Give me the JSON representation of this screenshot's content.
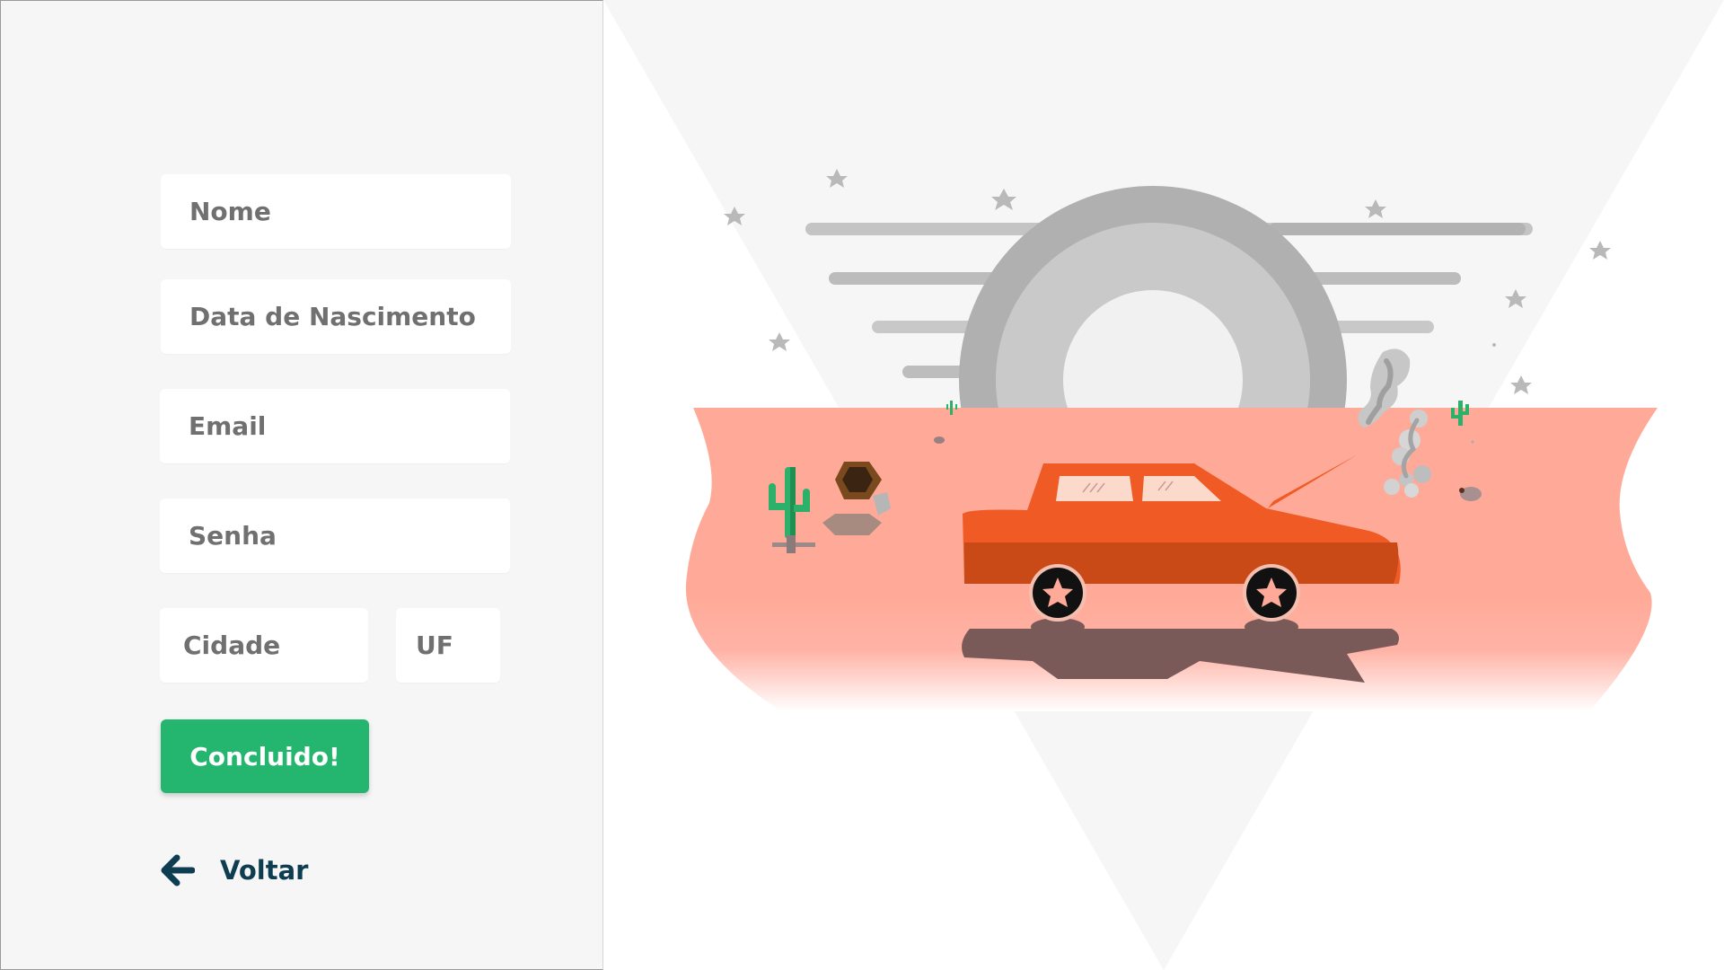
{
  "form": {
    "name_placeholder": "Nome",
    "birthdate_placeholder": "Data de Nascimento",
    "email_placeholder": "Email",
    "password_placeholder": "Senha",
    "city_placeholder": "Cidade",
    "state_placeholder": "UF",
    "submit_label": "Concluido!",
    "back_label": "Voltar"
  },
  "icons": {
    "back": "arrow-left-icon"
  },
  "colors": {
    "panel_background": "#f6f6f6",
    "submit_button": "#24b56f",
    "back_link": "#0e3d52",
    "desert": "#ffaa98",
    "car": "#f05a24",
    "cactus": "#2db06a"
  }
}
